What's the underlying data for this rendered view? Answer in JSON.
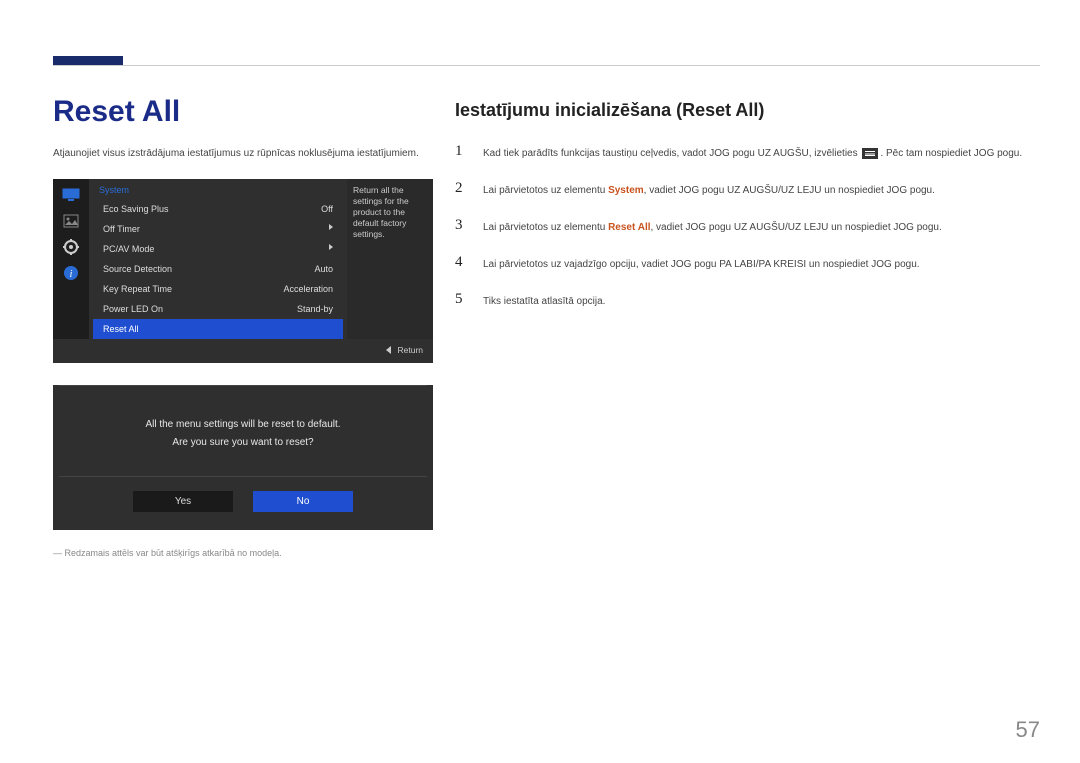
{
  "page_number": "57",
  "left": {
    "title": "Reset All",
    "intro": "Atjaunojiet visus izstrādājuma iestatījumus uz rūpnīcas noklusējuma iestatījumiem.",
    "footnote": "Redzamais attēls var būt atšķirīgs atkarībā no modeļa."
  },
  "osd": {
    "header": "System",
    "rows": [
      {
        "label": "Eco Saving Plus",
        "value": "Off"
      },
      {
        "label": "Off Timer",
        "value": "▸"
      },
      {
        "label": "PC/AV Mode",
        "value": "▸"
      },
      {
        "label": "Source Detection",
        "value": "Auto"
      },
      {
        "label": "Key Repeat Time",
        "value": "Acceleration"
      },
      {
        "label": "Power LED On",
        "value": "Stand-by"
      }
    ],
    "selected": "Reset All",
    "desc": "Return all the settings for the product to the default factory settings.",
    "footer": "Return"
  },
  "dialog": {
    "line1": "All the menu settings will be reset to default.",
    "line2": "Are you sure you want to reset?",
    "yes": "Yes",
    "no": "No"
  },
  "right": {
    "title": "Iestatījumu inicializēšana (Reset All)",
    "step5": "Tiks iestatīta atlasītā opcija.",
    "s1a": "Kad tiek parādīts funkcijas taustiņu ceļvedis, vadot JOG pogu UZ AUGŠU, izvēlieties ",
    "s1b": ". Pēc tam nospiediet JOG pogu.",
    "s2a": "Lai pārvietotos uz elementu ",
    "s2hl": "System",
    "s2b": ", vadiet JOG pogu UZ AUGŠU/UZ LEJU un nospiediet JOG pogu.",
    "s3a": "Lai pārvietotos uz elementu ",
    "s3hl": "Reset All",
    "s3b": ", vadiet JOG pogu UZ AUGŠU/UZ LEJU un nospiediet JOG pogu.",
    "s4": "Lai pārvietotos uz vajadzīgo opciju, vadiet JOG pogu PA LABI/PA KREISI un nospiediet JOG pogu."
  }
}
